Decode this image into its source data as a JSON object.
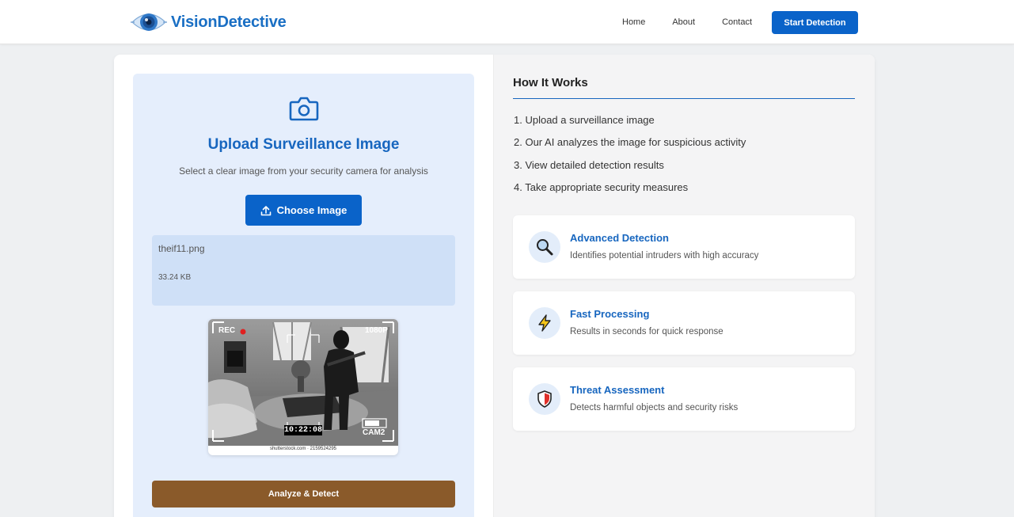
{
  "brand": {
    "name": "VisionDetective",
    "logo_icon": "eye-logo-icon"
  },
  "nav": {
    "links": [
      "Home",
      "About",
      "Contact"
    ],
    "cta_label": "Start Detection"
  },
  "upload": {
    "icon": "camera-icon",
    "title": "Upload Surveillance Image",
    "subtitle": "Select a clear image from your security camera for analysis",
    "choose_label": "Choose Image",
    "choose_icon": "upload-icon",
    "file": {
      "name": "theif11.png",
      "size": "33.24 KB"
    },
    "preview": {
      "rec_label": "REC",
      "resolution": "1080P",
      "timestamp": "10:22:08",
      "camera": "CAM2",
      "watermark": "shutterstock.com · 2159524295"
    },
    "analyze_label": "Analyze & Detect"
  },
  "how": {
    "title": "How It Works",
    "steps": [
      "1. Upload a surveillance image",
      "2. Our AI analyzes the image for suspicious activity",
      "3. View detailed detection results",
      "4. Take appropriate security measures"
    ]
  },
  "features": [
    {
      "icon": "magnifier-icon",
      "title": "Advanced Detection",
      "desc": "Identifies potential intruders with high accuracy"
    },
    {
      "icon": "lightning-icon",
      "title": "Fast Processing",
      "desc": "Results in seconds for quick response"
    },
    {
      "icon": "shield-icon",
      "title": "Threat Assessment",
      "desc": "Detects harmful objects and security risks"
    }
  ],
  "colors": {
    "primary": "#0a63c9",
    "accent_text": "#1766bf",
    "analyze_button": "#8a5a2a",
    "upload_panel": "#e5eefc",
    "rec_dot": "#e02020"
  }
}
